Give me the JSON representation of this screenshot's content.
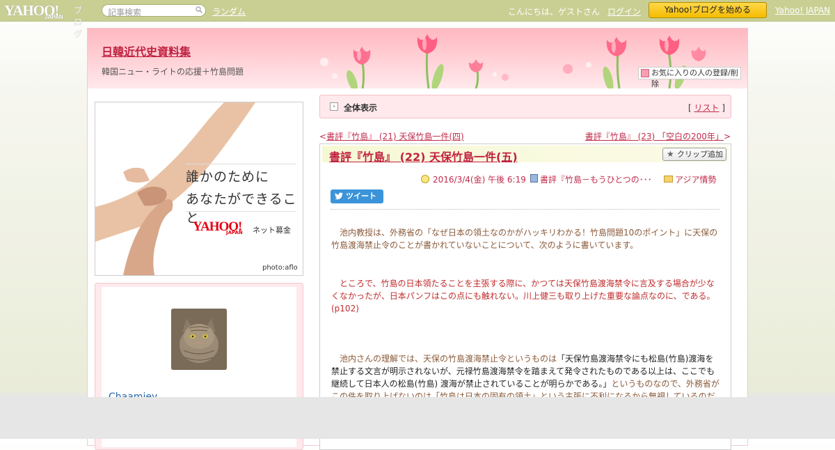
{
  "topbar": {
    "logo": "YAHOO!",
    "logo_sub": "JAPAN",
    "logo_blog": "ブログ",
    "search_placeholder": "記事検索",
    "random": "ランダム",
    "greeting": "こんにちは、ゲストさん",
    "login": "ログイン",
    "start_blog": "Yahoo!ブログを始める",
    "yahoo_japan": "Yahoo! JAPAN"
  },
  "header": {
    "blog_title": "日韓近代史資料集",
    "blog_desc": "韓国ニュー・ライトの応援＋竹島問題",
    "fav_button": "お気に入りの人の登録/削除"
  },
  "ad": {
    "line1": "誰かのために",
    "line2": "あなたができること",
    "logo": "YAHOO!",
    "logo_sub": "JAPAN",
    "service": "ネット募金",
    "credit": "photo:aflo"
  },
  "profile": {
    "username": "Chaamiey"
  },
  "main": {
    "view_all": "全体表示",
    "list_link": "リスト",
    "prev_link": "書評『竹島』 (21) 天保竹島一件(四)",
    "next_link": "書評『竹島』 (23) 「空白の200年」",
    "prev_arrow": "<",
    "next_arrow": ">"
  },
  "article": {
    "title": "書評『竹島』 (22) 天保竹島一件(五)",
    "clip_button": "クリップ追加",
    "date": "2016/3/4(金) 午後 6:19",
    "book_category": "書評『竹島－もうひとつの･･･",
    "category": "アジア情勢",
    "tweet": "ツイート",
    "para1": "　池内教授は、外務省の「なぜ日本の領土なのかがハッキリわかる！竹島問題10のポイント」に天保の竹島渡海禁止令のことが書かれていないことについて、次のように書いています。",
    "para2": "　ところで、竹島の日本領たることを主張する際に、かつては天保竹島渡海禁令に言及する場合が少なくなかったが、日本パンフはこの点にも触れない。川上健三も取り上げた重要な論点なのに、である。(p102)",
    "para3_a": "　池内さんの理解では、天保の竹島渡海禁止令というものは",
    "para3_q": "「天保竹島渡海禁令にも松島(竹島)渡海を禁止する文言が明示されないが、元禄竹島渡海禁令を踏まえて発令されたものである以上は、ここでも継続して日本人の松島(竹島) 渡海が禁止されていることが明らかである。」",
    "para3_b": "というものなので、外務省がこの件を取り上げないのは「竹島は日本の固有の領土」という主張に不利になるから無視しているのだと言っているのです。"
  }
}
